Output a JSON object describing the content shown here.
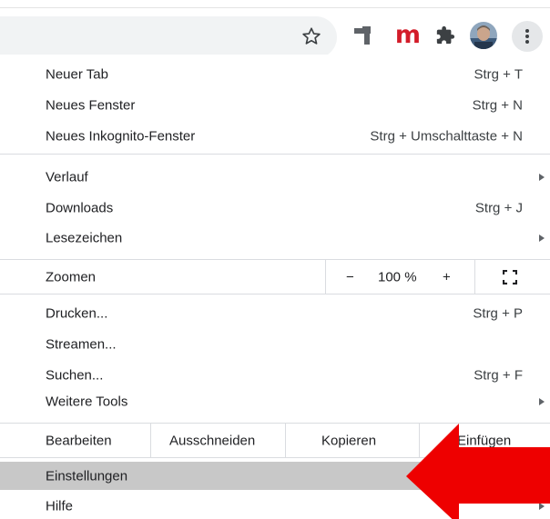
{
  "toolbar": {
    "icons": [
      "star-icon",
      "extension-icon",
      "m-extension-icon",
      "puzzle-icon",
      "avatar",
      "kebab-icon"
    ],
    "m_extension_letter": "m"
  },
  "menu": {
    "items": [
      {
        "label": "Neuer Tab",
        "shortcut": "Strg + T"
      },
      {
        "label": "Neues Fenster",
        "shortcut": "Strg + N"
      },
      {
        "label": "Neues Inkognito-Fenster",
        "shortcut": "Strg + Umschalttaste + N"
      },
      {
        "label": "Verlauf",
        "submenu": true
      },
      {
        "label": "Downloads",
        "shortcut": "Strg + J"
      },
      {
        "label": "Lesezeichen",
        "submenu": true
      },
      {
        "label": "Drucken...",
        "shortcut": "Strg + P"
      },
      {
        "label": "Streamen..."
      },
      {
        "label": "Suchen...",
        "shortcut": "Strg + F"
      },
      {
        "label": "Weitere Tools",
        "submenu": true
      },
      {
        "label": "Einstellungen",
        "highlighted": true
      },
      {
        "label": "Hilfe",
        "submenu": true
      }
    ],
    "zoom": {
      "label": "Zoomen",
      "minus": "−",
      "value": "100 %",
      "plus": "+"
    },
    "edit": {
      "label": "Bearbeiten",
      "cut": "Ausschneiden",
      "copy": "Kopieren",
      "paste": "Einfügen"
    }
  },
  "colors": {
    "highlight": "#c8c8c8",
    "annotation_arrow": "#ee0000",
    "m_extension": "#d31c29"
  }
}
